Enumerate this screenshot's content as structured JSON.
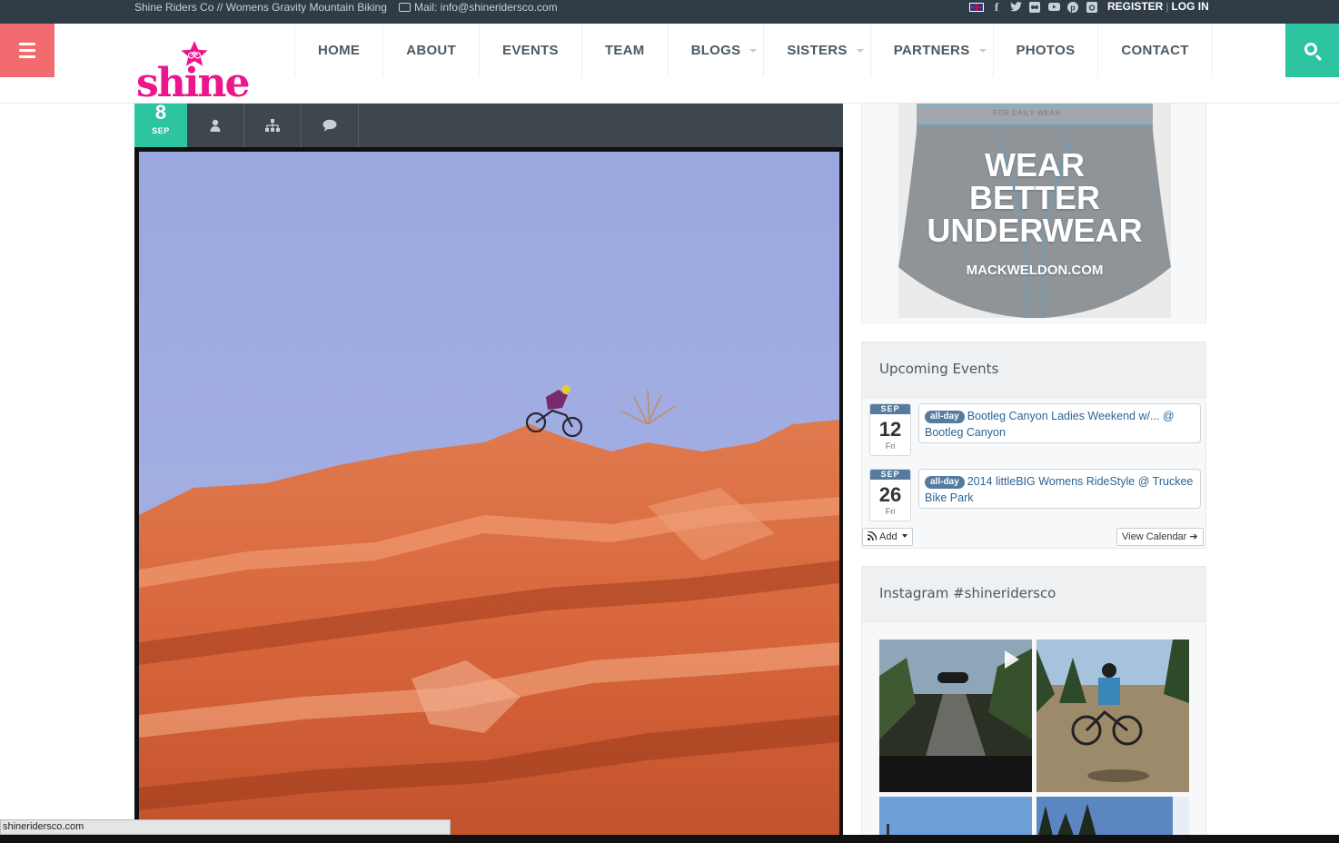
{
  "topbar": {
    "tagline": "Shine Riders Co // Womens Gravity Mountain Biking",
    "mail": "Mail: info@shineridersco.com",
    "register": "REGISTER",
    "separator": "|",
    "login": "LOG IN",
    "social_icons": [
      "uk-flag-icon",
      "facebook-icon",
      "twitter-icon",
      "flickr-icon",
      "youtube-icon",
      "pinterest-icon",
      "instagram-icon"
    ]
  },
  "header": {
    "logo_text": "shine",
    "nav": [
      "HOME",
      "ABOUT",
      "EVENTS",
      "TEAM",
      "BLOGS",
      "SISTERS",
      "PARTNERS",
      "PHOTOS",
      "CONTACT"
    ],
    "nav_dropdowns": [
      "BLOGS",
      "SISTERS",
      "PARTNERS"
    ],
    "colors": {
      "menu_button": "#f26b6e",
      "search_button": "#2cc4a1",
      "logo": "#ec168c"
    }
  },
  "post": {
    "day": "8",
    "month": "SEP",
    "meta_icons": [
      "user-icon",
      "sitemap-icon",
      "comment-icon"
    ]
  },
  "ad": {
    "tag": "FOR DAILY WEAR",
    "line1": "WEAR",
    "line2": "BETTER",
    "line3": "UNDERWEAR",
    "url": "MACKWELDON.COM"
  },
  "events_widget": {
    "title": "Upcoming Events",
    "events": [
      {
        "month": "SEP",
        "day": "12",
        "weekday": "Fri",
        "badge": "all-day",
        "text": "Bootleg Canyon Ladies Weekend w/... @ Bootleg Canyon"
      },
      {
        "month": "SEP",
        "day": "26",
        "weekday": "Fri",
        "badge": "all-day",
        "text": "2014 littleBIG Womens RideStyle @ Truckee Bike Park"
      }
    ],
    "add_label": "Add",
    "view_calendar_label": "View Calendar"
  },
  "instagram_widget": {
    "title": "Instagram #shineridersco"
  },
  "statusbar": {
    "url": "shineridersco.com"
  }
}
